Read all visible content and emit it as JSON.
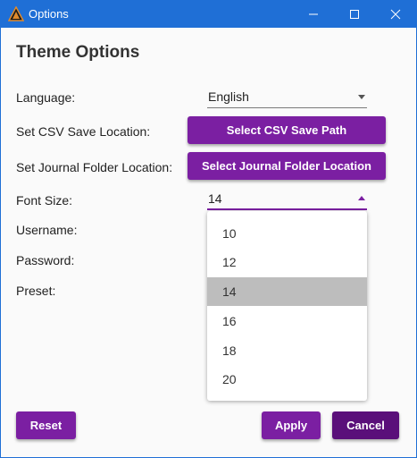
{
  "window": {
    "title": "Options",
    "accent_color": "#1f6fd6",
    "icons": {
      "app": "app-logo-icon",
      "minimize": "minimize-icon",
      "maximize": "maximize-icon",
      "close": "close-icon"
    }
  },
  "heading": "Theme Options",
  "form": {
    "language_label": "Language:",
    "language_value": "English",
    "csv_label": "Set CSV Save Location:",
    "csv_button": "Select CSV Save Path",
    "journal_label": "Set Journal Folder Location:",
    "journal_button": "Select Journal Folder Location",
    "font_size_label": "Font Size:",
    "font_size_value": "14",
    "username_label": "Username:",
    "password_label": "Password:",
    "preset_label": "Preset:"
  },
  "font_size_dropdown": {
    "options": [
      "10",
      "12",
      "14",
      "16",
      "18",
      "20"
    ],
    "selected": "14"
  },
  "footer": {
    "reset_label": "Reset",
    "apply_label": "Apply",
    "cancel_label": "Cancel"
  },
  "colors": {
    "primary_button": "#7b1fa2",
    "cancel_button": "#5a0f7a",
    "selected_option": "#bdbdbd"
  }
}
